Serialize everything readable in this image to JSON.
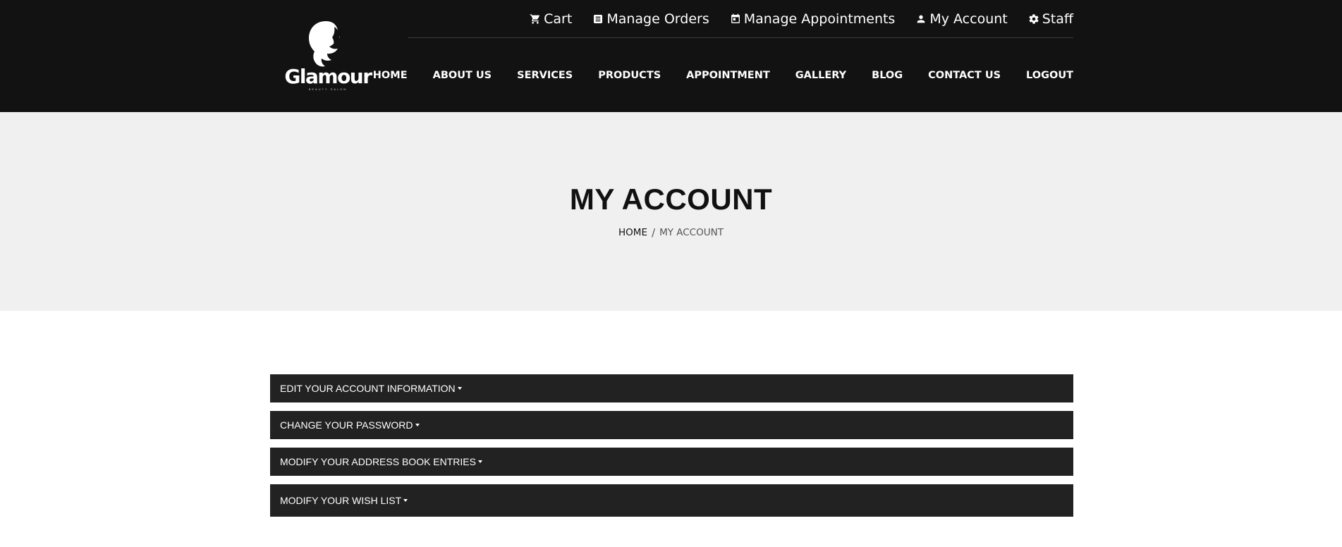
{
  "brand": {
    "name": "Glamour",
    "tagline": "BEAUTY SALON"
  },
  "topbar": {
    "items": [
      {
        "label": "Cart",
        "icon": "cart-icon"
      },
      {
        "label": "Manage Orders",
        "icon": "receipt-icon"
      },
      {
        "label": "Manage Appointments",
        "icon": "calendar-icon"
      },
      {
        "label": "My Account",
        "icon": "user-icon"
      },
      {
        "label": "Staff",
        "icon": "gear-icon"
      }
    ]
  },
  "nav": {
    "items": [
      "HOME",
      "ABOUT US",
      "SERVICES",
      "PRODUCTS",
      "APPOINTMENT",
      "GALLERY",
      "BLOG",
      "CONTACT US",
      "LOGOUT"
    ]
  },
  "banner": {
    "title": "MY ACCOUNT",
    "breadcrumb": {
      "home": "HOME",
      "separator": "/",
      "current": "MY ACCOUNT"
    }
  },
  "account": {
    "sections": [
      {
        "label": "EDIT YOUR ACCOUNT INFORMATION"
      },
      {
        "label": "CHANGE YOUR PASSWORD"
      },
      {
        "label": "MODIFY YOUR ADDRESS BOOK ENTRIES"
      },
      {
        "label": "MODIFY YOUR WISH LIST"
      }
    ]
  },
  "colors": {
    "header_bg": "#121212",
    "banner_bg": "#f0f0f0",
    "accordion_bg": "#222222"
  }
}
